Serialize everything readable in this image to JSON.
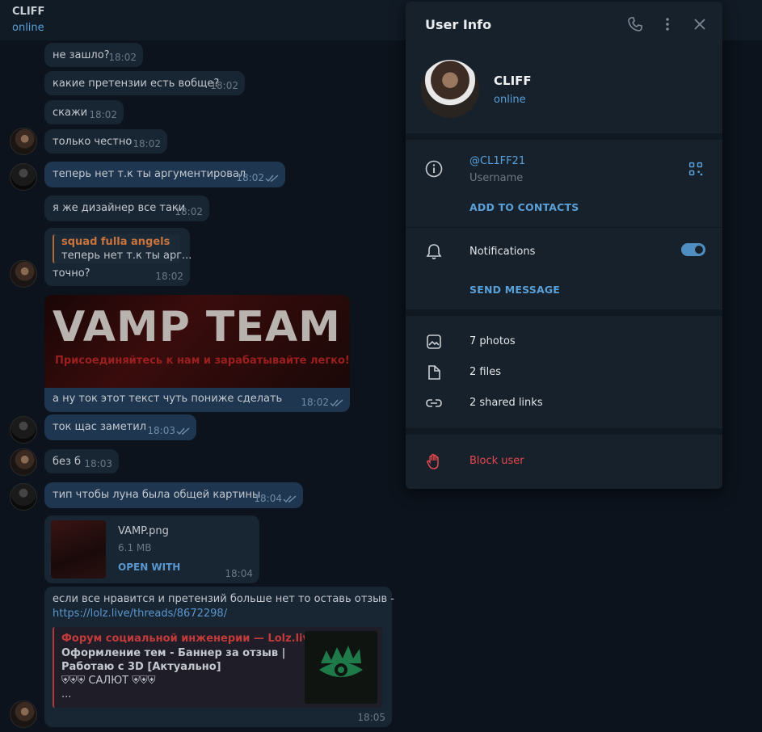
{
  "chat": {
    "title": "CLIFF",
    "status": "online"
  },
  "messages": [
    {
      "text": "не зашло?",
      "time": "18:02"
    },
    {
      "text": "какие претензии есть вобще?",
      "time": "18:02"
    },
    {
      "text": "скажи",
      "time": "18:02"
    },
    {
      "text": "только честно",
      "time": "18:02"
    },
    {
      "text": "теперь нет т.к ты аргументировал",
      "time": "18:02"
    },
    {
      "text": "я же дизайнер все таки",
      "time": "18:02"
    },
    {
      "reply_name": "squad fulla angels",
      "reply_text": "теперь нет т.к ты арг...",
      "text": "точно?",
      "time": "18:02"
    },
    {
      "banner_title": "VAMP TEAM",
      "banner_sub": "Присоединяйтесь к нам и зарабатывайте легко!",
      "text": "а ну ток этот текст чуть пониже сделать",
      "time": "18:02"
    },
    {
      "text": "ток щас заметил",
      "time": "18:03"
    },
    {
      "text": "без б",
      "time": "18:03"
    },
    {
      "text": "тип чтобы луна была общей картины",
      "time": "18:04"
    },
    {
      "file_name": "VAMP.png",
      "file_size": "6.1 MB",
      "open_with": "OPEN WITH",
      "time": "18:04"
    },
    {
      "text": "если все нравится и претензий больше нет то оставь отзыв -",
      "link": "https://lolz.live/threads/8672298/",
      "preview_site": "Форум социальной инженерии —  Lolz.live...",
      "preview_title": "Оформление тем - Баннер за отзыв | Работаю с 3D [Актуально]",
      "preview_line3": "⛨⛨⛨ САЛЮТ ⛨⛨⛨",
      "preview_more": "...",
      "time": "18:05"
    }
  ],
  "panel": {
    "title": "User Info",
    "name": "CLIFF",
    "status": "online",
    "username": "@CL1FF21",
    "username_label": "Username",
    "add_contacts": "ADD TO CONTACTS",
    "notifications": "Notifications",
    "notifications_on": true,
    "send_message": "SEND MESSAGE",
    "photos": "7 photos",
    "files": "2 files",
    "links": "2 shared links",
    "block": "Block user"
  }
}
